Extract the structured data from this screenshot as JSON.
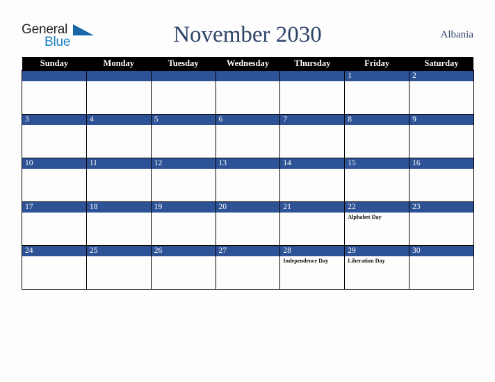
{
  "brand": {
    "name_part1": "General",
    "name_part2": "Blue",
    "triangle_icon": "triangle-icon",
    "colors": {
      "dark": "#231f20",
      "blue": "#1b83c5",
      "triangle": "#1767ab"
    }
  },
  "header": {
    "title": "November 2030",
    "country": "Albania",
    "title_color": "#2e4468"
  },
  "calendar": {
    "weekday_headers": [
      "Sunday",
      "Monday",
      "Tuesday",
      "Wednesday",
      "Thursday",
      "Friday",
      "Saturday"
    ],
    "colors": {
      "header_bg": "#000000",
      "header_text": "#ffffff",
      "daynum_bg": "#2e5296",
      "daynum_text": "#ffffff",
      "cell_bg": "#fdfdfd",
      "grid_line": "#000000"
    },
    "weeks": [
      [
        {
          "day": "",
          "event": ""
        },
        {
          "day": "",
          "event": ""
        },
        {
          "day": "",
          "event": ""
        },
        {
          "day": "",
          "event": ""
        },
        {
          "day": "",
          "event": ""
        },
        {
          "day": "1",
          "event": ""
        },
        {
          "day": "2",
          "event": ""
        }
      ],
      [
        {
          "day": "3",
          "event": ""
        },
        {
          "day": "4",
          "event": ""
        },
        {
          "day": "5",
          "event": ""
        },
        {
          "day": "6",
          "event": ""
        },
        {
          "day": "7",
          "event": ""
        },
        {
          "day": "8",
          "event": ""
        },
        {
          "day": "9",
          "event": ""
        }
      ],
      [
        {
          "day": "10",
          "event": ""
        },
        {
          "day": "11",
          "event": ""
        },
        {
          "day": "12",
          "event": ""
        },
        {
          "day": "13",
          "event": ""
        },
        {
          "day": "14",
          "event": ""
        },
        {
          "day": "15",
          "event": ""
        },
        {
          "day": "16",
          "event": ""
        }
      ],
      [
        {
          "day": "17",
          "event": ""
        },
        {
          "day": "18",
          "event": ""
        },
        {
          "day": "19",
          "event": ""
        },
        {
          "day": "20",
          "event": ""
        },
        {
          "day": "21",
          "event": ""
        },
        {
          "day": "22",
          "event": "Alphabet Day"
        },
        {
          "day": "23",
          "event": ""
        }
      ],
      [
        {
          "day": "24",
          "event": ""
        },
        {
          "day": "25",
          "event": ""
        },
        {
          "day": "26",
          "event": ""
        },
        {
          "day": "27",
          "event": ""
        },
        {
          "day": "28",
          "event": "Independence Day"
        },
        {
          "day": "29",
          "event": "Liberation Day"
        },
        {
          "day": "30",
          "event": ""
        }
      ]
    ]
  }
}
